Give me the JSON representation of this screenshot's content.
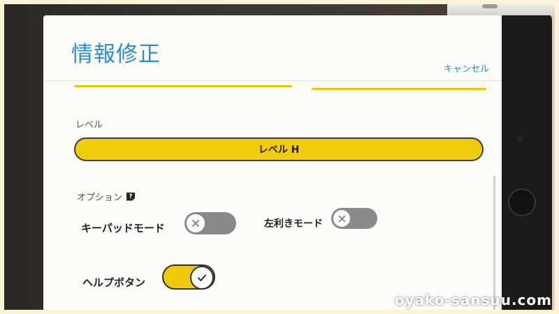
{
  "header": {
    "title": "情報修正",
    "cancel_label": "キャンセル"
  },
  "level": {
    "section_label": "レベル",
    "selected_value": "レベル H"
  },
  "options": {
    "section_label": "オプション",
    "help_glyph": "?",
    "keypad_mode": {
      "label": "キーパッドモード",
      "state": "off"
    },
    "left_hand_mode": {
      "label": "左利きモード",
      "state": "off"
    },
    "help_button": {
      "label": "ヘルプボタン",
      "state": "on"
    }
  },
  "watermark": "oyako-sansuu.com",
  "colors": {
    "accent_blue": "#2a8fd0",
    "accent_yellow": "#f0cc0c",
    "toggle_off": "#8a8a88"
  },
  "icons": {
    "toggle_off_knob": "close-icon",
    "toggle_on_knob": "check-icon",
    "options_help": "help-icon"
  }
}
